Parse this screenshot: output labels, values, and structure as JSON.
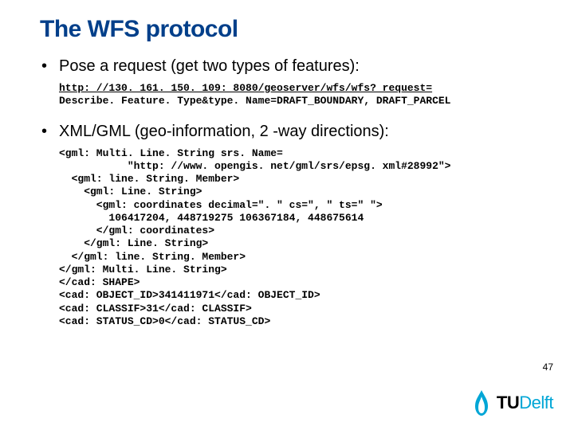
{
  "title": "The WFS protocol",
  "bullet1": "Pose a request (get two types of features):",
  "code1_line1": "http: //130. 161. 150. 109: 8080/geoserver/wfs/wfs? request=",
  "code1_line2": "Describe. Feature. Type&type. Name=DRAFT_BOUNDARY, DRAFT_PARCEL",
  "bullet2": "XML/GML (geo-information, 2 -way directions):",
  "code2": "<gml: Multi. Line. String srs. Name=\n           \"http: //www. opengis. net/gml/srs/epsg. xml#28992\">\n  <gml: line. String. Member>\n    <gml: Line. String>\n      <gml: coordinates decimal=\". \" cs=\", \" ts=\" \">\n        106417204, 448719275 106367184, 448675614\n      </gml: coordinates>\n    </gml: Line. String>\n  </gml: line. String. Member>\n</gml: Multi. Line. String>\n</cad: SHAPE>\n<cad: OBJECT_ID>341411971</cad: OBJECT_ID>\n<cad: CLASSIF>31</cad: CLASSIF>\n<cad: STATUS_CD>0</cad: STATUS_CD>",
  "page_number": "47",
  "logo": {
    "tu": "TU",
    "delft": "Delft"
  }
}
